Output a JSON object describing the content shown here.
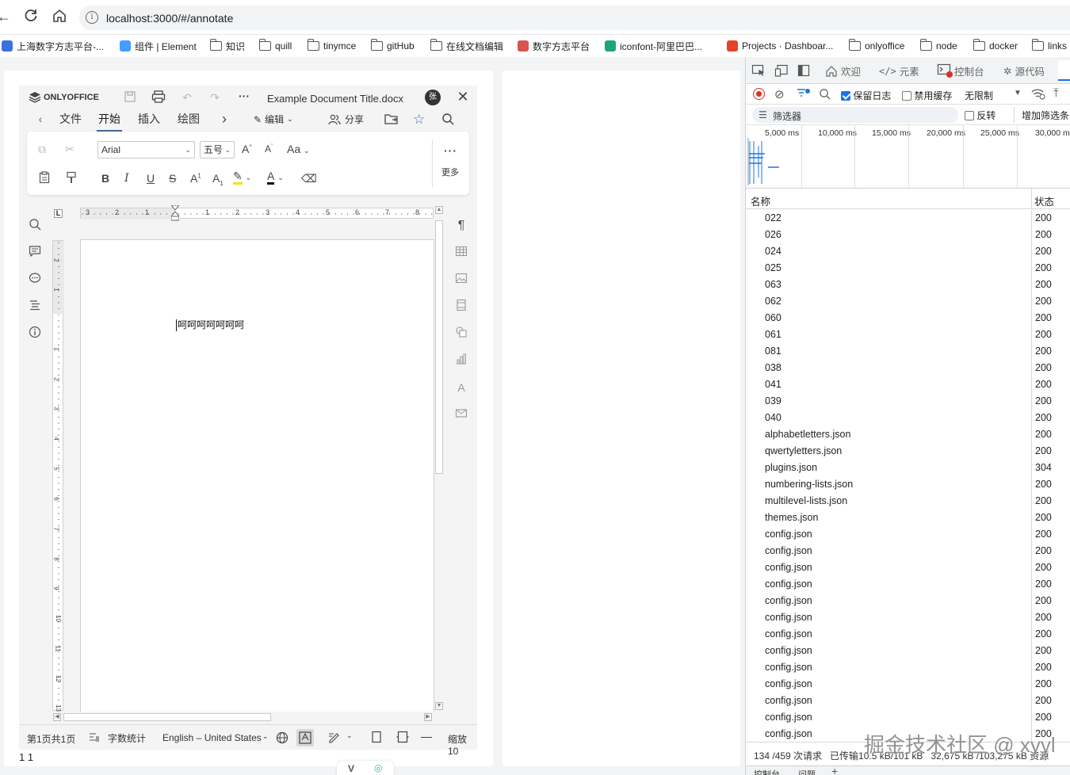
{
  "browser": {
    "url": "localhost:3000/#/annotate",
    "bookmarks": [
      {
        "label": "上海数字方志平台-...",
        "icon": "site-icon",
        "color": "#3c6fe0"
      },
      {
        "label": "组件 | Element",
        "icon": "element-icon",
        "color": "#409eff"
      },
      {
        "label": "知识",
        "icon": "folder-icon"
      },
      {
        "label": "quill",
        "icon": "folder-icon"
      },
      {
        "label": "tinymce",
        "icon": "folder-icon"
      },
      {
        "label": "gitHub",
        "icon": "folder-icon"
      },
      {
        "label": "在线文档编辑",
        "icon": "folder-icon"
      },
      {
        "label": "数字方志平台",
        "icon": "site-icon",
        "color": "#d9534f"
      },
      {
        "label": "iconfont-阿里巴巴...",
        "icon": "iconfont-icon",
        "color": "#1fa37a"
      },
      {
        "label": "Projects · Dashboar...",
        "icon": "gitlab-icon",
        "color": "#e24329"
      },
      {
        "label": "onlyoffice",
        "icon": "folder-icon"
      },
      {
        "label": "node",
        "icon": "folder-icon"
      },
      {
        "label": "docker",
        "icon": "folder-icon"
      },
      {
        "label": "links",
        "icon": "folder-icon"
      }
    ]
  },
  "editor": {
    "brand": "ONLYOFFICE",
    "doc_title": "Example Document Title.docx",
    "avatar": "张",
    "tabs": [
      "文件",
      "开始",
      "插入",
      "绘图"
    ],
    "active_tab": "开始",
    "edit_label": "编辑",
    "share_label": "分享",
    "font_name": "Arial",
    "font_size": "五号",
    "more_label": "更多",
    "doc_text": "呵呵呵呵呵呵呵",
    "ruler_numbers_h": [
      "3",
      "2",
      "1",
      "1",
      "2",
      "3",
      "4",
      "5",
      "6",
      "7",
      "8"
    ],
    "ruler_numbers_v": [
      "2",
      "1",
      "1",
      "2",
      "3",
      "4",
      "5",
      "6",
      "7",
      "8",
      "9",
      "10",
      "11",
      "12",
      "13"
    ],
    "status": {
      "page_info": "第1页共1页",
      "word_count": "字数统计",
      "language": "English – United States",
      "zoom": "缩放10"
    },
    "footer_text": "1 1"
  },
  "devtools": {
    "tabs": [
      "欢迎",
      "元素",
      "控制台",
      "源代码"
    ],
    "preserve_log": "保留日志",
    "disable_cache": "禁用缓存",
    "throttle": "无限制",
    "filter_label": "筛选器",
    "invert_label": "反转",
    "more_filters": "增加筛选条",
    "timeline_labels": [
      "5,000 ms",
      "10,000 ms",
      "15,000 ms",
      "20,000 ms",
      "25,000 ms",
      "30,000 ms"
    ],
    "col_name": "名称",
    "col_status": "状态",
    "requests": [
      {
        "name": "022",
        "status": "200"
      },
      {
        "name": "026",
        "status": "200"
      },
      {
        "name": "024",
        "status": "200"
      },
      {
        "name": "025",
        "status": "200"
      },
      {
        "name": "063",
        "status": "200"
      },
      {
        "name": "062",
        "status": "200"
      },
      {
        "name": "060",
        "status": "200"
      },
      {
        "name": "061",
        "status": "200"
      },
      {
        "name": "081",
        "status": "200"
      },
      {
        "name": "038",
        "status": "200"
      },
      {
        "name": "041",
        "status": "200"
      },
      {
        "name": "039",
        "status": "200"
      },
      {
        "name": "040",
        "status": "200"
      },
      {
        "name": "alphabetletters.json",
        "status": "200"
      },
      {
        "name": "qwertyletters.json",
        "status": "200"
      },
      {
        "name": "plugins.json",
        "status": "304"
      },
      {
        "name": "numbering-lists.json",
        "status": "200"
      },
      {
        "name": "multilevel-lists.json",
        "status": "200"
      },
      {
        "name": "themes.json",
        "status": "200"
      },
      {
        "name": "config.json",
        "status": "200"
      },
      {
        "name": "config.json",
        "status": "200"
      },
      {
        "name": "config.json",
        "status": "200"
      },
      {
        "name": "config.json",
        "status": "200"
      },
      {
        "name": "config.json",
        "status": "200"
      },
      {
        "name": "config.json",
        "status": "200"
      },
      {
        "name": "config.json",
        "status": "200"
      },
      {
        "name": "config.json",
        "status": "200"
      },
      {
        "name": "config.json",
        "status": "200"
      },
      {
        "name": "config.json",
        "status": "200"
      },
      {
        "name": "config.json",
        "status": "200"
      },
      {
        "name": "config.json",
        "status": "200"
      },
      {
        "name": "config.json",
        "status": "200"
      }
    ],
    "summary": "134 /459 次请求   已传输10.5 kB/101 kB   32,675 kB /103,275 kB 资源",
    "bottom_tabs": [
      "控制台",
      "问题"
    ]
  },
  "watermark": "掘金技术社区 @ xyyl"
}
